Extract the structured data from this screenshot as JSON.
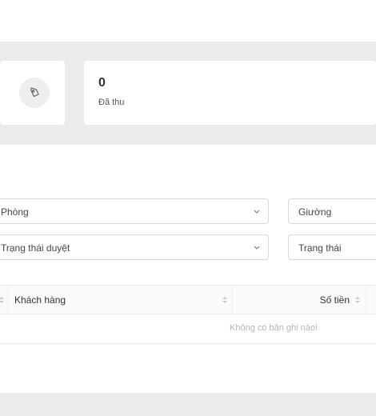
{
  "stats": {
    "left_icon": "money-note-icon",
    "collected_value": "0",
    "collected_label": "Đã thu"
  },
  "filters": {
    "room": "Phòng",
    "bed": "Giường",
    "approval_status": "Trạng thái duyệt",
    "status": "Trạng thái"
  },
  "table": {
    "columns": [
      "Khách hàng",
      "Số tiền"
    ],
    "empty_text": "Không có bản ghi nào!"
  }
}
